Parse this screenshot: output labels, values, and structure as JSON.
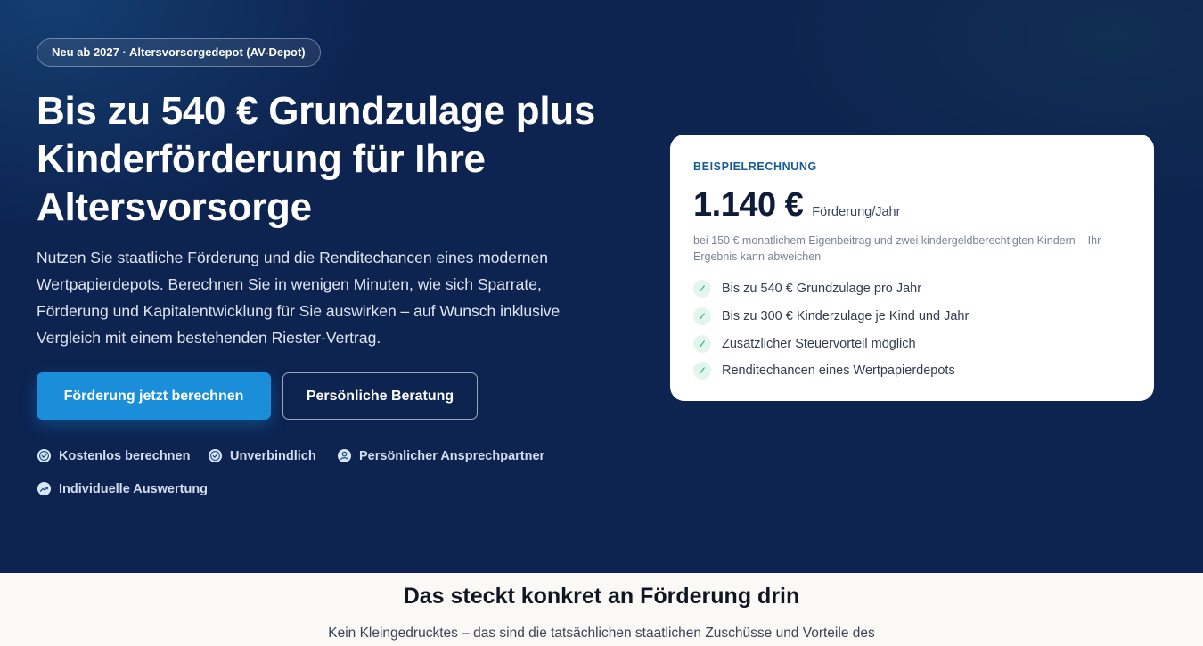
{
  "hero": {
    "badge": "Neu ab 2027 · Altersvorsorgedepot (AV-Depot)",
    "headline": "Bis zu 540 € Grundzulage plus Kinderförderung für Ihre Altersvorsorge",
    "intro": "Nutzen Sie staatliche Förderung und die Renditechancen eines modernen Wertpapierdepots. Berechnen Sie in wenigen Minuten, wie sich Sparrate, Förderung und Kapitalentwicklung für Sie auswirken – auf Wunsch inklusive Vergleich mit einem bestehenden Riester-Vertrag.",
    "primary_button": "Förderung jetzt berechnen",
    "secondary_button": "Persönliche Beratung",
    "trust_items": [
      {
        "label": "Kostenlos berechnen",
        "icon": "check-circle-icon"
      },
      {
        "label": "Unverbindlich",
        "icon": "check-circle-icon"
      },
      {
        "label": "Persönlicher Ansprechpartner",
        "icon": "user-circle-icon"
      },
      {
        "label": "Individuelle Auswertung",
        "icon": "trend-up-icon"
      }
    ]
  },
  "card": {
    "label": "BEISPIELRECHNUNG",
    "amount": "1.140 €",
    "unit": "Förderung/Jahr",
    "note": "bei 150 € monatlichem Eigenbeitrag und zwei kindergeldberechtigten Kindern – Ihr Ergebnis kann abweichen",
    "check_symbol": "✓",
    "benefits": [
      "Bis zu 540 € Grundzulage pro Jahr",
      "Bis zu 300 € Kinderzulage je Kind und Jahr",
      "Zusätzlicher Steuervorteil möglich",
      "Renditechancen eines Wertpapierdepots"
    ]
  },
  "section": {
    "title": "Das steckt konkret an Förderung drin",
    "subtitle": "Kein Kleingedrucktes – das sind die tatsächlichen staatlichen Zuschüsse und Vorteile des"
  },
  "colors": {
    "hero_background": "#0d2350",
    "primary_button": "#1a8ed8",
    "card_label": "#175b9a",
    "check_green": "#17a673"
  }
}
